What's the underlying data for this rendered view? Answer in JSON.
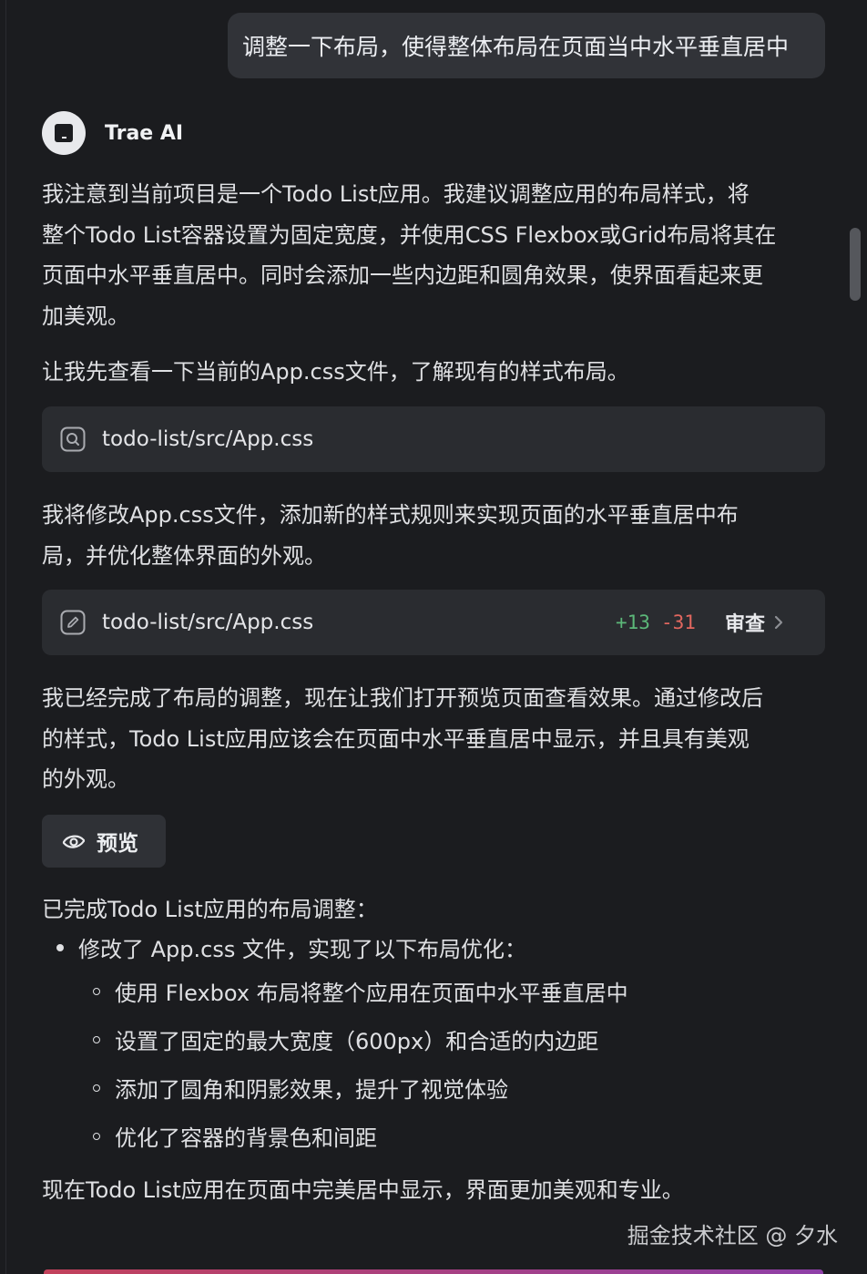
{
  "user_message": "调整一下布局，使得整体布局在页面当中水平垂直居中",
  "assistant": {
    "name": "Trae AI"
  },
  "para1": [
    "我注意到当前项目是一个Todo List应用。我建议调整应用的布局样式，将",
    "整个Todo List容器设置为固定宽度，并使用CSS Flexbox或Grid布局将其在",
    "页面中水平垂直居中。同时会添加一些内边距和圆角效果，使界面看起来更",
    "加美观。"
  ],
  "para2": "让我先查看一下当前的App.css文件，了解现有的样式布局。",
  "search_card": {
    "icon": "search-file-icon",
    "path": "todo-list/src/App.css"
  },
  "para3": [
    "我将修改App.css文件，添加新的样式规则来实现页面的水平垂直居中布",
    "局，并优化整体界面的外观。"
  ],
  "edit_card": {
    "icon": "edit-icon",
    "path": "todo-list/src/App.css",
    "added": "+13",
    "removed": "-31",
    "review_label": "审查"
  },
  "para4": [
    "我已经完成了布局的调整，现在让我们打开预览页面查看效果。通过修改后",
    "的样式，Todo List应用应该会在页面中水平垂直居中显示，并且具有美观",
    "的外观。"
  ],
  "preview_button": {
    "icon": "preview-icon",
    "label": "预览"
  },
  "summary": {
    "title": "已完成Todo List应用的布局调整：",
    "item": "修改了 App.css 文件，实现了以下布局优化：",
    "subitems": [
      "使用 Flexbox 布局将整个应用在页面中水平垂直居中",
      "设置了固定的最大宽度（600px）和合适的内边距",
      "添加了圆角和阴影效果，提升了视觉体验",
      "优化了容器的背景色和间距"
    ]
  },
  "final_line": "现在Todo List应用在页面中完美居中显示，界面更加美观和专业。",
  "watermark": "掘金技术社区 @ 夕水",
  "colors": {
    "background": "#1b1c1f",
    "bubble": "#313338",
    "card": "#2a2c30",
    "diff_add": "#5cb879",
    "diff_del": "#e2675f"
  }
}
